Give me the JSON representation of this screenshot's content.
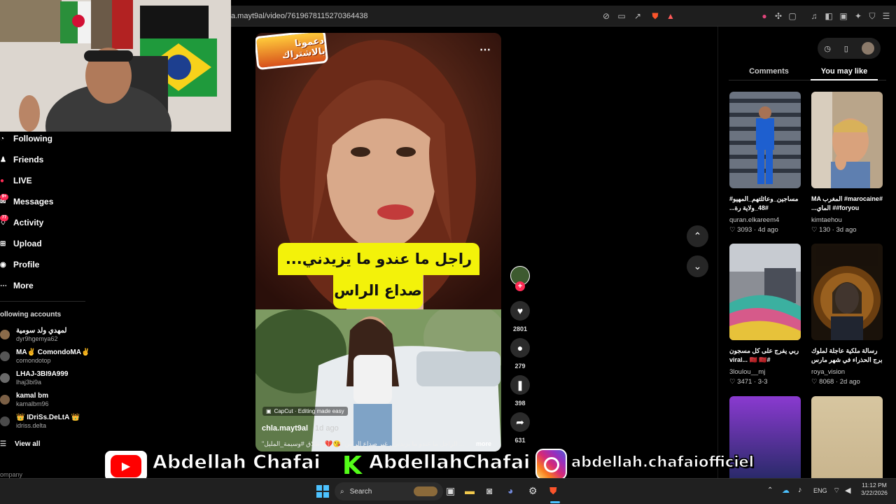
{
  "browser": {
    "url": "a.mayt9al/video/7619678115270364438"
  },
  "sidebar": {
    "nav": [
      {
        "label": "Following",
        "icon": "following-icon"
      },
      {
        "label": "Friends",
        "icon": "friends-icon"
      },
      {
        "label": "LIVE",
        "icon": "live-icon"
      },
      {
        "label": "Messages",
        "icon": "messages-icon",
        "badge": "9+"
      },
      {
        "label": "Activity",
        "icon": "activity-icon",
        "badge": "77"
      },
      {
        "label": "Upload",
        "icon": "upload-icon"
      },
      {
        "label": "Profile",
        "icon": "profile-icon"
      },
      {
        "label": "More",
        "icon": "more-icon"
      }
    ],
    "following_header": "ollowing accounts",
    "accounts": [
      {
        "name": "لمهدي ولد سومية",
        "handle": "dyr9hgemya62"
      },
      {
        "name": "MA✌ ComondoMA✌",
        "handle": "comondotop"
      },
      {
        "name": "LHAJ-3BI9A999",
        "handle": "lhaj3bi9a"
      },
      {
        "name": "kamal bm",
        "handle": "kamalbm96"
      },
      {
        "name": "👑 IDriSs.DeLtA 👑",
        "handle": "idriss.delta"
      }
    ],
    "view_all": "View all",
    "company": "ompany"
  },
  "video": {
    "sticker_text": "دعمونا بالاشتراك",
    "caption_line1": "راجل ما عندو ما يزيدني... غير",
    "caption_line2": "صداع الراس",
    "capcut_label": "CapCut · Editing made easy",
    "author": "chla.mayt9al",
    "age": "1d ago",
    "description": "\"الراجل ما عندو ما يزيدني.. غير صداع الراس\" 😘💔 #طلاق #وسيمة_المليل ...",
    "more": "more"
  },
  "actions": {
    "likes": "2801",
    "comments": "279",
    "saves": "398",
    "shares": "631"
  },
  "right_panel": {
    "tabs": [
      "Comments",
      "You may like"
    ],
    "active_tab": "You may like",
    "cards": [
      {
        "title": "مساجين_وعائلتهم_المهيو# #48_ولاية رة...",
        "user": "quran.elkareem4",
        "likes": "3093",
        "age": "4d ago"
      },
      {
        "title": "#marocaine# المغرب MA #foryou# الماي...",
        "user": "kimtaehou",
        "likes": "130",
        "age": "3d ago"
      },
      {
        "title": "ربي يفرج على كل مسجون #viral... 🇲🇦 🇲🇦",
        "user": "3loulou__mj",
        "likes": "3471",
        "age": "3-3"
      },
      {
        "title": "رسالة ملكية عاجلة لملوك برج الحذراء في شهر مارس",
        "user": "roya_vision",
        "likes": "8068",
        "age": "2d ago"
      }
    ]
  },
  "social": {
    "youtube": "Abdellah Chafai",
    "kick": "AbdellahChafai",
    "instagram": "abdellah.chafaiofficiel"
  },
  "taskbar": {
    "search": "Search",
    "lang": "ENG",
    "time": "11:12 PM",
    "date": "3/22/2026"
  },
  "colors": {
    "caption_yellow": "#f3f20a",
    "like_red": "#fe2c55",
    "youtube_red": "#ff0000",
    "kick_green": "#53fc18"
  }
}
